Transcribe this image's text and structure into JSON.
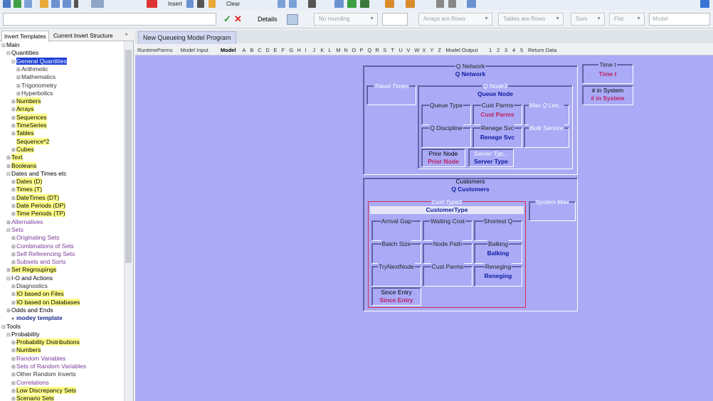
{
  "ribbon": {
    "insert_label": "Insert",
    "clear_label": "Clear"
  },
  "toolbar": {
    "details": "Details",
    "rounding": "No rounding",
    "arrays": "Arrays are Rows",
    "tables": "Tables are Rows",
    "sum": "Sum",
    "flat": "Flat",
    "model": "Model"
  },
  "left_tabs": [
    "Invert Templates",
    "Current Invert Structure"
  ],
  "tree": [
    {
      "t": "Main",
      "d": 0,
      "g": "⊟"
    },
    {
      "t": "Quantities",
      "d": 1,
      "g": "⊟"
    },
    {
      "t": "General Quantities",
      "d": 2,
      "g": "⊟",
      "c": "sel"
    },
    {
      "t": "Arithmetic",
      "d": 3,
      "g": "⊞",
      "c": "dark"
    },
    {
      "t": "Mathematics",
      "d": 3,
      "g": "⊞",
      "c": "dark"
    },
    {
      "t": "Trigonometry",
      "d": 3,
      "g": "⊞",
      "c": "dark"
    },
    {
      "t": "Hyperbolics",
      "d": 3,
      "g": "⊞",
      "c": "dark"
    },
    {
      "t": "Numbers",
      "d": 2,
      "g": "⊞",
      "c": "hl"
    },
    {
      "t": "Arrays",
      "d": 2,
      "g": "⊞",
      "c": "hl"
    },
    {
      "t": "Sequences",
      "d": 2,
      "g": "⊞",
      "c": "hl"
    },
    {
      "t": "TimeSeries",
      "d": 2,
      "g": "⊞",
      "c": "hl"
    },
    {
      "t": "Tables",
      "d": 2,
      "g": "⊞",
      "c": "hl"
    },
    {
      "t": "Sequence*2",
      "d": 2,
      "g": "",
      "c": "hl"
    },
    {
      "t": "Cubes",
      "d": 2,
      "g": "⊞",
      "c": "hl"
    },
    {
      "t": "Text",
      "d": 1,
      "g": "⊞",
      "c": "hl"
    },
    {
      "t": "Booleans",
      "d": 1,
      "g": "⊞",
      "c": "hl"
    },
    {
      "t": "Dates and Times etc",
      "d": 1,
      "g": "⊟"
    },
    {
      "t": "Dates (D)",
      "d": 2,
      "g": "⊞",
      "c": "hl"
    },
    {
      "t": "Times (T)",
      "d": 2,
      "g": "⊞",
      "c": "hl"
    },
    {
      "t": "DateTimes (DT)",
      "d": 2,
      "g": "⊞",
      "c": "hl"
    },
    {
      "t": "Date Periods (DP)",
      "d": 2,
      "g": "⊞",
      "c": "hl"
    },
    {
      "t": "Time Periods (TP)",
      "d": 2,
      "g": "⊞",
      "c": "hl"
    },
    {
      "t": "Alternatives",
      "d": 1,
      "g": "⊞",
      "c": "purple"
    },
    {
      "t": "Sets",
      "d": 1,
      "g": "⊟",
      "c": "purple"
    },
    {
      "t": "Originating Sets",
      "d": 2,
      "g": "⊞",
      "c": "purple"
    },
    {
      "t": "Combinations of Sets",
      "d": 2,
      "g": "⊞",
      "c": "purple"
    },
    {
      "t": "Self Referencing Sets",
      "d": 2,
      "g": "⊞",
      "c": "purple"
    },
    {
      "t": "Subsets and Sorts",
      "d": 2,
      "g": "⊞",
      "c": "purple"
    },
    {
      "t": "Set Regroupings",
      "d": 1,
      "g": "⊞",
      "c": "hl"
    },
    {
      "t": "I-O and Actions",
      "d": 1,
      "g": "⊟"
    },
    {
      "t": "Diagnostics",
      "d": 2,
      "g": "⊞",
      "c": "dark"
    },
    {
      "t": "IO based on Files",
      "d": 2,
      "g": "⊞",
      "c": "hl"
    },
    {
      "t": "IO based on Databases",
      "d": 2,
      "g": "⊞",
      "c": "hl"
    },
    {
      "t": "Odds and Ends",
      "d": 1,
      "g": "⊞"
    },
    {
      "t": "modey template",
      "d": 2,
      "g": "●",
      "c": "bold"
    },
    {
      "t": "Tools",
      "d": 0,
      "g": "⊟"
    },
    {
      "t": "Probability",
      "d": 1,
      "g": "⊟"
    },
    {
      "t": "Probability Distributions",
      "d": 2,
      "g": "⊞",
      "c": "hl"
    },
    {
      "t": "Numbers",
      "d": 2,
      "g": "⊞",
      "c": "hl"
    },
    {
      "t": "Random Variables",
      "d": 2,
      "g": "⊞",
      "c": "purple"
    },
    {
      "t": "Sets of Random Variables",
      "d": 2,
      "g": "⊞",
      "c": "purple"
    },
    {
      "t": "Other Random Inverts",
      "d": 2,
      "g": "⊞",
      "c": "dark"
    },
    {
      "t": "Correlations",
      "d": 2,
      "g": "⊞",
      "c": "purple"
    },
    {
      "t": "Low Discrepancy Sets",
      "d": 2,
      "g": "⊞",
      "c": "hl"
    },
    {
      "t": "Scenario Sets",
      "d": 2,
      "g": "⊞",
      "c": "hl"
    }
  ],
  "main_tab": "New Queueing Model Program",
  "sheet_tabs": [
    "RuntimeParms",
    "Model Input",
    "Model",
    "A",
    "B",
    "C",
    "D",
    "E",
    "F",
    "G",
    "H",
    "I",
    "J",
    "K",
    "L",
    "M",
    "N",
    "O",
    "P",
    "Q",
    "R",
    "S",
    "T",
    "U",
    "V",
    "W",
    "X",
    "Y",
    "Z",
    "Model Output",
    "1",
    "2",
    "3",
    "4",
    "5",
    "Return Data"
  ],
  "sheet_active": "Model",
  "model": {
    "q_network": {
      "cap": "Q Network",
      "val": "Q Network"
    },
    "travel_times": {
      "cap": "Travel Times"
    },
    "q_node3": {
      "cap": "Q Node3",
      "val": "Queue Node"
    },
    "queue_type": {
      "cap": "Queue Type"
    },
    "cust_parms": {
      "cap": "Cust Parms",
      "val": "Cust Parms"
    },
    "max_q_len": {
      "cap": "Max Q Len..."
    },
    "q_discipline": {
      "cap": "Q Discipline"
    },
    "renege_svc": {
      "cap": "Renege Svc",
      "val": "Renege Svc"
    },
    "bulk_service": {
      "cap": "Bulk Service"
    },
    "prior_node": {
      "cap": "Prior Node",
      "val": "Prior Node"
    },
    "server_type": {
      "cap": "Server Typ...",
      "val": "Server Type"
    },
    "time_t": {
      "cap": "Time t",
      "val": "Time t"
    },
    "n_in_system": {
      "cap": "# in System",
      "val": "# in System"
    },
    "customers": {
      "cap": "Customers",
      "val": "Q Customers"
    },
    "cust_type1": {
      "cap": "Cust Type1",
      "val": "CustomerType"
    },
    "system_max": {
      "cap": "System Max"
    },
    "arrival_gap": {
      "cap": "Arrival Gap"
    },
    "waiting_cost": {
      "cap": "Waiting Cost"
    },
    "shortest_q": {
      "cap": "Shortest Q"
    },
    "batch_size": {
      "cap": "Batch Size"
    },
    "node_path": {
      "cap": "Node Path"
    },
    "balking": {
      "cap": "Balking",
      "val": "Balking"
    },
    "try_next_node": {
      "cap": "TryNextNode"
    },
    "cust_parms2": {
      "cap": "Cust Parms"
    },
    "reneging": {
      "cap": "Reneging",
      "val": "Reneging"
    },
    "since_entry": {
      "cap": "Since Entry",
      "val": "Since Entry"
    }
  }
}
